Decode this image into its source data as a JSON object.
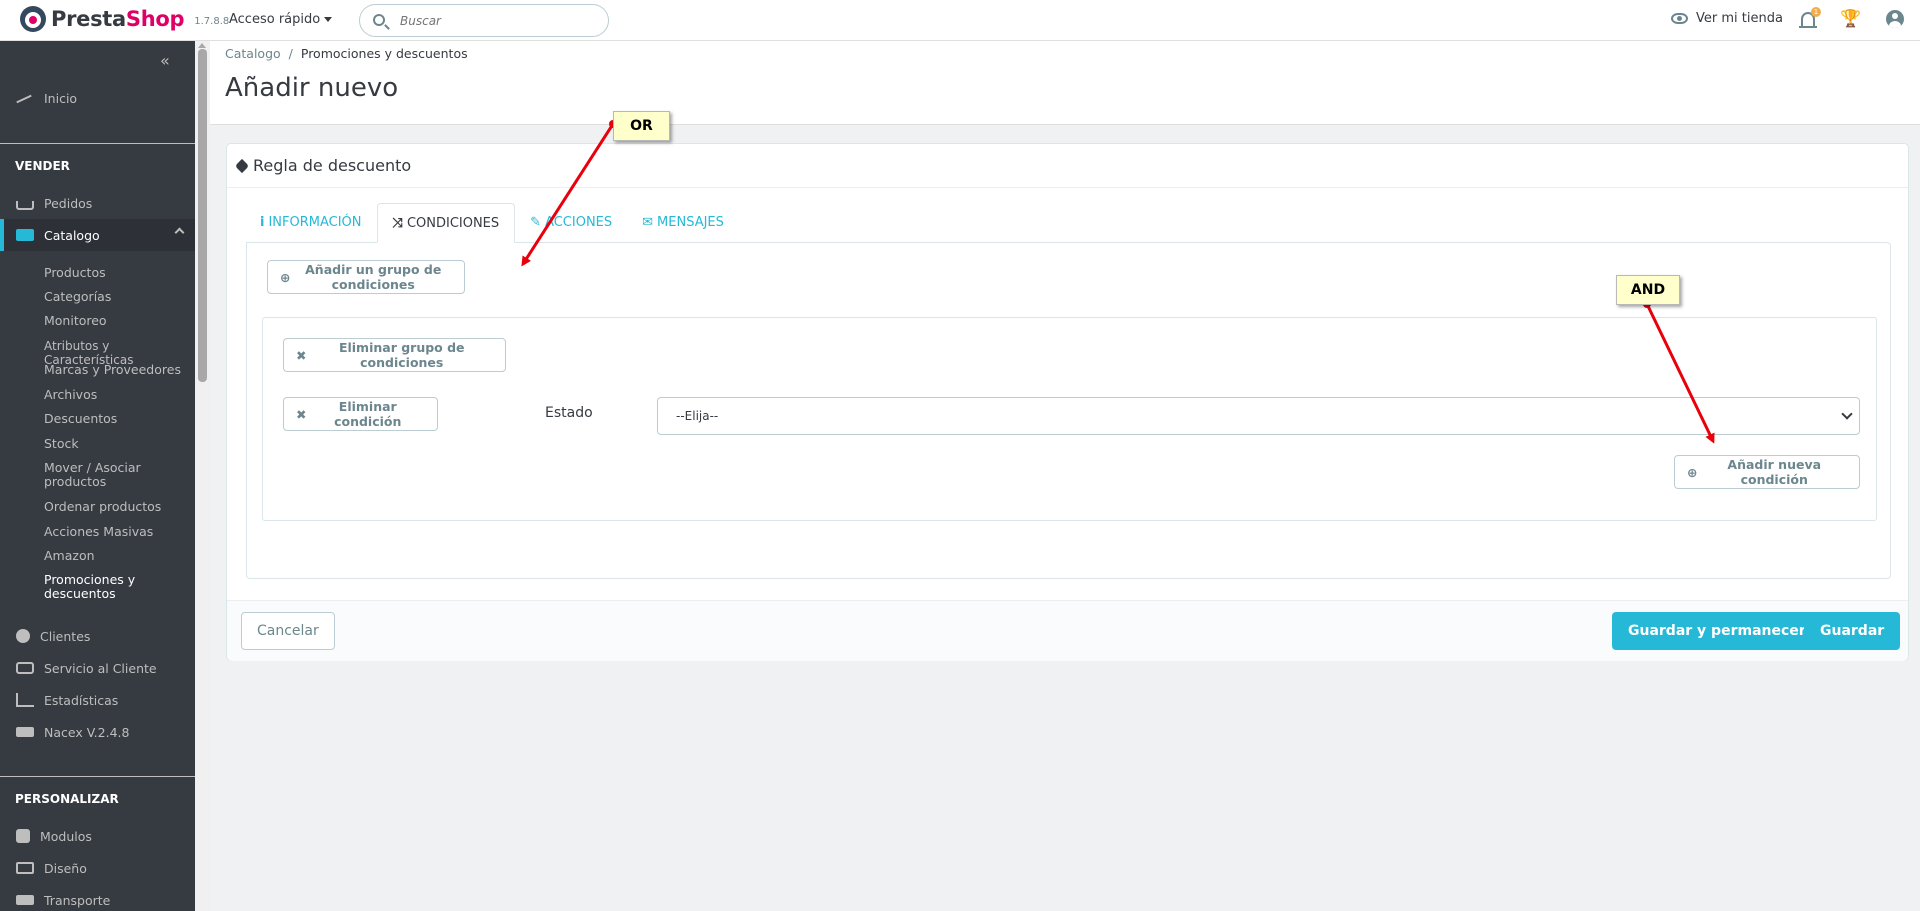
{
  "header": {
    "logo_prefix": "Presta",
    "logo_suffix": "Shop",
    "version": "1.7.8.8",
    "quick_access": "Acceso rápido",
    "search_placeholder": "Buscar",
    "view_store": "Ver mi tienda",
    "notifications_count": "1"
  },
  "sidebar": {
    "collapse_glyph": "«",
    "inicio": "Inicio",
    "section_sell": "VENDER",
    "pedidos": "Pedidos",
    "catalogo": "Catalogo",
    "catalog_items": [
      "Productos",
      "Categorías",
      "Monitoreo",
      "Atributos y Características",
      "Marcas y Proveedores",
      "Archivos",
      "Descuentos",
      "Stock",
      "Mover / Asociar productos",
      "Ordenar productos",
      "Acciones Masivas",
      "Amazon",
      "Promociones y descuentos"
    ],
    "clientes": "Clientes",
    "servicio": "Servicio al Cliente",
    "estadisticas": "Estadísticas",
    "nacex": "Nacex V.2.4.8",
    "section_customize": "PERSONALIZAR",
    "modulos": "Modulos",
    "diseno": "Diseño",
    "transporte": "Transporte"
  },
  "breadcrumb": {
    "parent": "Catalogo",
    "separator": "/",
    "current": "Promociones y descuentos"
  },
  "page_title": "Añadir nuevo",
  "panel": {
    "heading": "Regla de descuento",
    "tabs": [
      {
        "icon": "i",
        "label": "INFORMACIÓN"
      },
      {
        "icon": "⤨",
        "label": "CONDICIONES"
      },
      {
        "icon": "✎",
        "label": "ACCIONES"
      },
      {
        "icon": "✉",
        "label": "MENSAJES"
      }
    ],
    "add_group": "Añadir un grupo de condiciones",
    "remove_group": "Eliminar grupo de condiciones",
    "remove_condition": "Eliminar condición",
    "estado_label": "Estado",
    "estado_value": "--Elija--",
    "add_condition": "Añadir nueva condición"
  },
  "footer": {
    "cancel": "Cancelar",
    "save_stay": "Guardar y permanecer",
    "save": "Guardar"
  },
  "annotations": {
    "or_label": "OR",
    "and_label": "AND",
    "arrow_color": "#e8000b"
  },
  "colors": {
    "accent": "#25b9d7",
    "sidebar_bg": "#363a41",
    "brand_pink": "#df0067"
  }
}
